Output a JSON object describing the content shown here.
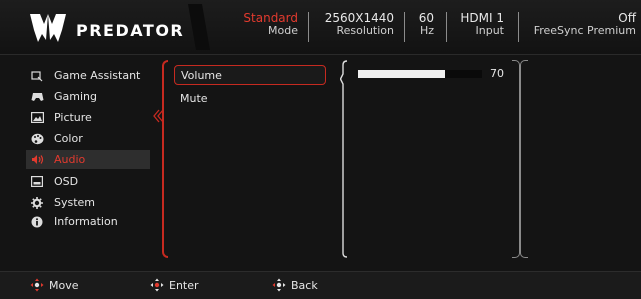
{
  "brand": {
    "name": "PREDATOR",
    "logo_icon": "predator-logo-icon"
  },
  "status": [
    {
      "value": "Standard",
      "label": "Mode",
      "value_color": "#e23a2e"
    },
    {
      "value": "2560X1440",
      "label": "Resolution"
    },
    {
      "value": "60",
      "label": "Hz"
    },
    {
      "value": "HDMI 1",
      "label": "Input"
    },
    {
      "value": "Off",
      "label": "FreeSync Premium"
    }
  ],
  "menu": {
    "items": [
      {
        "label": "Game Assistant",
        "icon": "game-assistant-icon"
      },
      {
        "label": "Gaming",
        "icon": "gamepad-icon"
      },
      {
        "label": "Picture",
        "icon": "picture-icon"
      },
      {
        "label": "Color",
        "icon": "palette-icon"
      },
      {
        "label": "Audio",
        "icon": "speaker-icon",
        "active": true
      },
      {
        "label": "OSD",
        "icon": "osd-icon"
      },
      {
        "label": "System",
        "icon": "gear-icon"
      },
      {
        "label": "Information",
        "icon": "info-icon"
      }
    ]
  },
  "submenu": {
    "options": [
      {
        "label": "Volume",
        "selected": true
      },
      {
        "label": "Mute"
      }
    ]
  },
  "volume": {
    "value": "70",
    "level_percent": 70
  },
  "footer": {
    "move_label": "Move",
    "enter_label": "Enter",
    "back_label": "Back"
  },
  "colors": {
    "accent": "#e23a2e",
    "background": "#141414"
  }
}
